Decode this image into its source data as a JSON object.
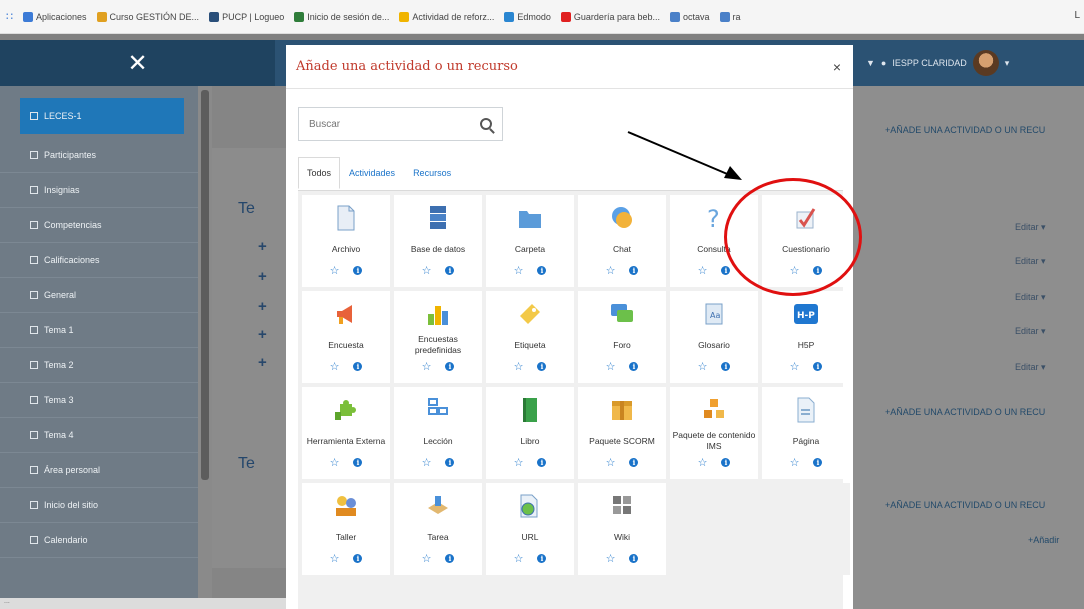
{
  "bookmarks": [
    {
      "label": "Aplicaciones",
      "color": "#3c7bd6"
    },
    {
      "label": "Curso GESTIÓN DE...",
      "color": "#e0a020"
    },
    {
      "label": "PUCP | Logueo",
      "color": "#2a4f7a"
    },
    {
      "label": "Inicio de sesión de...",
      "color": "#2f7d3a"
    },
    {
      "label": "Actividad de reforz...",
      "color": "#f0b400"
    },
    {
      "label": "Edmodo",
      "color": "#2a86d1"
    },
    {
      "label": "Guardería para beb...",
      "color": "#e02020"
    },
    {
      "label": "octava",
      "color": "#4a80c8"
    },
    {
      "label": "ra",
      "color": "#4a80c8"
    }
  ],
  "bookmarks_right": "L",
  "drawer": {
    "close_glyph": "✕"
  },
  "user": {
    "name": "IESPP CLARIDAD",
    "caret": "▾"
  },
  "sidebar": {
    "items": [
      {
        "label": "LECES-1",
        "active": true
      },
      {
        "label": "Participantes"
      },
      {
        "label": "Insignias"
      },
      {
        "label": "Competencias"
      },
      {
        "label": "Calificaciones"
      },
      {
        "label": "General"
      },
      {
        "label": "Tema 1"
      },
      {
        "label": "Tema 2"
      },
      {
        "label": "Tema 3"
      },
      {
        "label": "Tema 4"
      },
      {
        "label": "Área personal"
      },
      {
        "label": "Inicio del sitio"
      },
      {
        "label": "Calendario"
      }
    ]
  },
  "course": {
    "tema_label": "Te"
  },
  "right": {
    "add_activity": "+AÑADE UNA ACTIVIDAD O UN RECU",
    "add_short": "+Añadir",
    "editar": "Editar ▾"
  },
  "modal": {
    "title": "Añade una actividad o un recurso",
    "close": "×",
    "search_placeholder": "Buscar",
    "tabs": [
      "Todos",
      "Actividades",
      "Recursos"
    ],
    "tiles": [
      {
        "name": "Archivo",
        "icon": "file-icon"
      },
      {
        "name": "Base de datos",
        "icon": "database-icon"
      },
      {
        "name": "Carpeta",
        "icon": "folder-icon"
      },
      {
        "name": "Chat",
        "icon": "chat-icon"
      },
      {
        "name": "Consulta",
        "icon": "question-icon"
      },
      {
        "name": "Cuestionario",
        "icon": "quiz-check-icon"
      },
      {
        "name": "Encuesta",
        "icon": "megaphone-icon"
      },
      {
        "name": "Encuestas predefinidas",
        "icon": "bar-chart-icon"
      },
      {
        "name": "Etiqueta",
        "icon": "tag-icon"
      },
      {
        "name": "Foro",
        "icon": "forum-icon"
      },
      {
        "name": "Glosario",
        "icon": "glossary-icon"
      },
      {
        "name": "H5P",
        "icon": "h5p-icon",
        "badge": "H-P"
      },
      {
        "name": "Herramienta Externa",
        "icon": "puzzle-icon"
      },
      {
        "name": "Lección",
        "icon": "lesson-icon"
      },
      {
        "name": "Libro",
        "icon": "book-icon"
      },
      {
        "name": "Paquete SCORM",
        "icon": "package-icon"
      },
      {
        "name": "Paquete de contenido IMS",
        "icon": "ims-icon"
      },
      {
        "name": "Página",
        "icon": "page-icon"
      },
      {
        "name": "Taller",
        "icon": "workshop-icon"
      },
      {
        "name": "Tarea",
        "icon": "assignment-icon"
      },
      {
        "name": "URL",
        "icon": "url-icon"
      },
      {
        "name": "Wiki",
        "icon": "wiki-icon"
      }
    ],
    "star_glyph": "☆",
    "info_glyph": "i"
  },
  "status_bar": "...",
  "colors": {
    "accent": "#1a73c9",
    "title_red": "#c0392b",
    "annotation_red": "#e01010"
  }
}
